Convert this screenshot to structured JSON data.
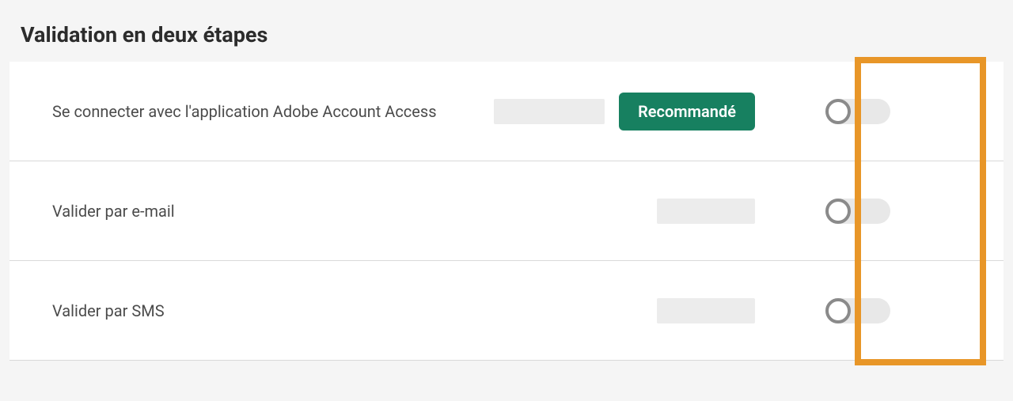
{
  "section": {
    "title": "Validation en deux étapes"
  },
  "options": [
    {
      "label": "Se connecter avec l'application Adobe Account Access",
      "badge": "Recommandé",
      "enabled": false
    },
    {
      "label": "Valider par e-mail",
      "enabled": false
    },
    {
      "label": "Valider par SMS",
      "enabled": false
    }
  ]
}
